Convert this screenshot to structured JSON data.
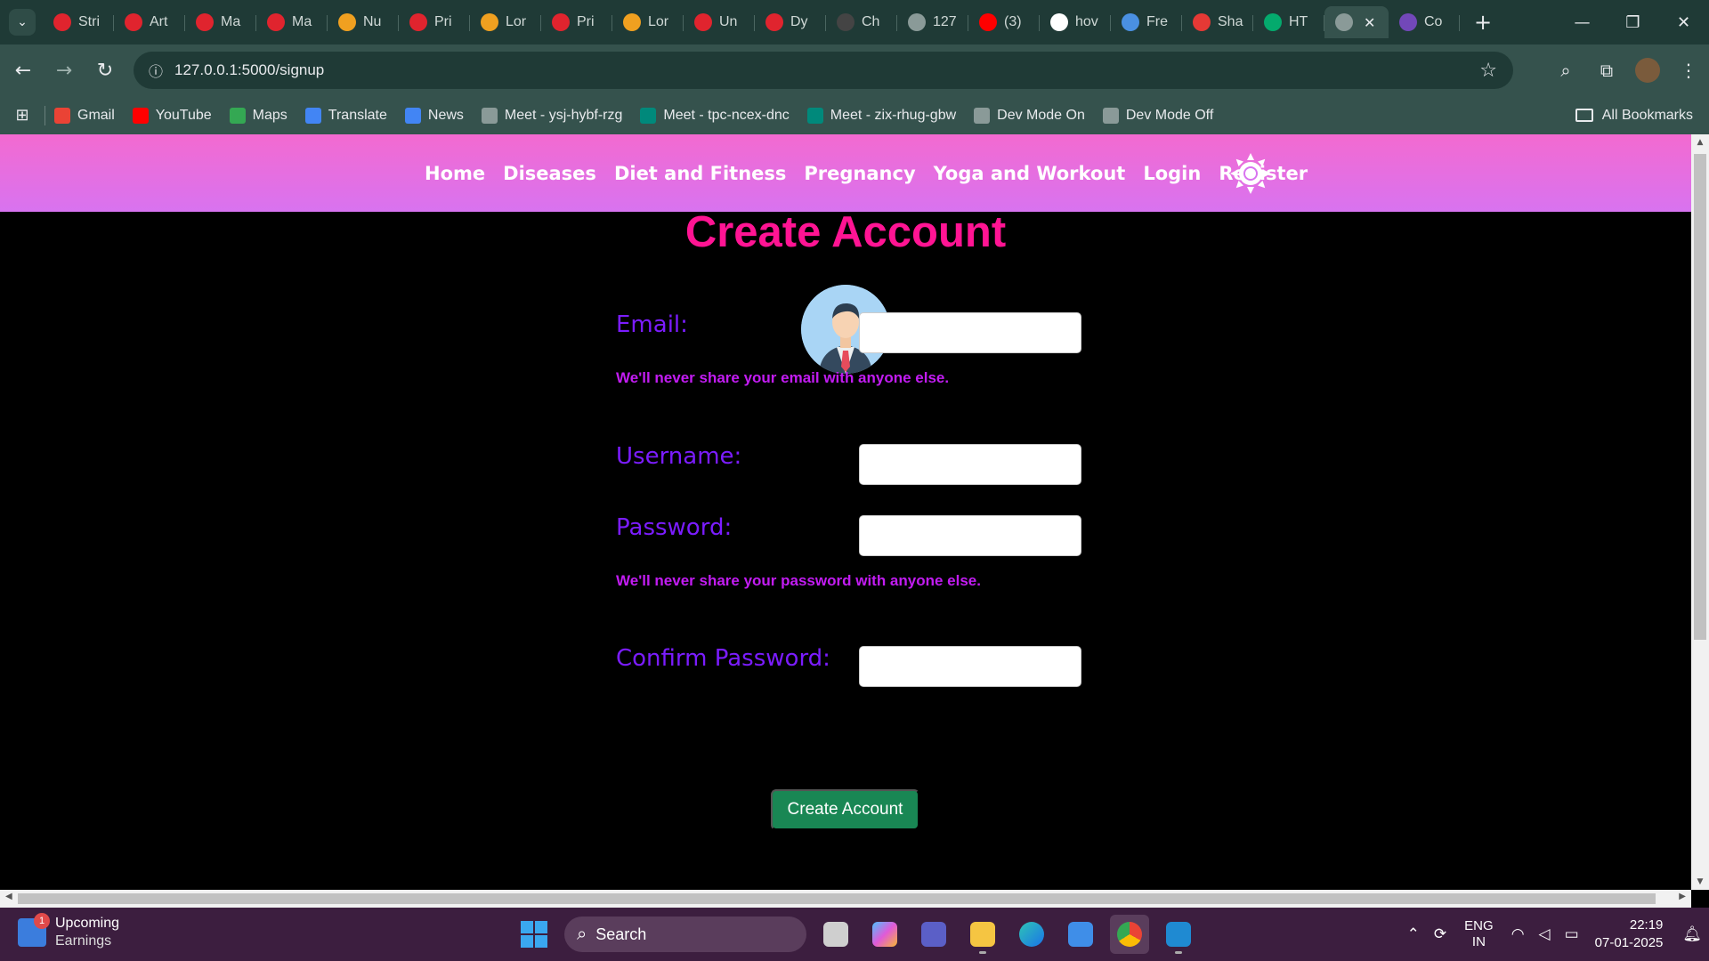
{
  "browser": {
    "tabs": [
      {
        "title": "Stri",
        "icon": "tuf-icon",
        "color": "#e0242e"
      },
      {
        "title": "Art",
        "icon": "tuf-icon",
        "color": "#e0242e"
      },
      {
        "title": "Ma",
        "icon": "tuf-icon",
        "color": "#e0242e"
      },
      {
        "title": "Ma",
        "icon": "tuf-icon",
        "color": "#e0242e"
      },
      {
        "title": "Nu",
        "icon": "leetcode-icon",
        "color": "#f0a020"
      },
      {
        "title": "Pri",
        "icon": "tuf-icon",
        "color": "#e0242e"
      },
      {
        "title": "Lor",
        "icon": "leetcode-icon",
        "color": "#f0a020"
      },
      {
        "title": "Pri",
        "icon": "tuf-icon",
        "color": "#e0242e"
      },
      {
        "title": "Lor",
        "icon": "leetcode-icon",
        "color": "#f0a020"
      },
      {
        "title": "Un",
        "icon": "tuf-icon",
        "color": "#e0242e"
      },
      {
        "title": "Dy",
        "icon": "tuf-icon",
        "color": "#e0242e"
      },
      {
        "title": "Ch",
        "icon": "chatgpt-icon",
        "color": "#444444"
      },
      {
        "title": "127",
        "icon": "globe-icon",
        "color": "#8a9a98"
      },
      {
        "title": "(3)",
        "icon": "youtube-icon",
        "color": "#ff0000"
      },
      {
        "title": "hov",
        "icon": "google-icon",
        "color": "#ffffff"
      },
      {
        "title": "Fre",
        "icon": "generic-icon",
        "color": "#4a90e2"
      },
      {
        "title": "Sha",
        "icon": "generic-icon",
        "color": "#e53935"
      },
      {
        "title": "HT",
        "icon": "w3schools-icon",
        "color": "#04aa6d"
      },
      {
        "title": "",
        "icon": "globe-icon",
        "color": "#8a9a98",
        "active": true
      },
      {
        "title": "Co",
        "icon": "forms-icon",
        "color": "#7248b9"
      }
    ],
    "url": "127.0.0.1:5000/signup",
    "bookmarks": [
      {
        "label": "Gmail",
        "icon": "gmail-icon",
        "color": "#ea4335"
      },
      {
        "label": "YouTube",
        "icon": "youtube-icon",
        "color": "#ff0000"
      },
      {
        "label": "Maps",
        "icon": "maps-icon",
        "color": "#34a853"
      },
      {
        "label": "Translate",
        "icon": "translate-icon",
        "color": "#4285f4"
      },
      {
        "label": "News",
        "icon": "news-icon",
        "color": "#4285f4"
      },
      {
        "label": "Meet - ysj-hybf-rzg",
        "icon": "globe-icon",
        "color": "#8a9a98"
      },
      {
        "label": "Meet - tpc-ncex-dnc",
        "icon": "meet-icon",
        "color": "#00897b"
      },
      {
        "label": "Meet - zix-rhug-gbw",
        "icon": "meet-icon",
        "color": "#00897b"
      },
      {
        "label": "Dev Mode On",
        "icon": "globe-icon",
        "color": "#8a9a98"
      },
      {
        "label": "Dev Mode Off",
        "icon": "globe-icon",
        "color": "#8a9a98"
      }
    ],
    "all_bookmarks": "All Bookmarks"
  },
  "site": {
    "nav": [
      "Home",
      "Diseases",
      "Diet and Fitness",
      "Pregnancy",
      "Yoga and Workout",
      "Login",
      "Register"
    ],
    "title": "Create Account",
    "form": {
      "email_label": "Email:",
      "email_help": "We'll never share your email with anyone else.",
      "username_label": "Username:",
      "password_label": "Password:",
      "password_help": "We'll never share your password with anyone else.",
      "confirm_label": "Confirm Password:",
      "submit": "Create Account"
    },
    "colors": {
      "nav_top": "#f36ad0",
      "title": "#ff1493",
      "label": "#7b1cff",
      "help": "#c21cf2",
      "button": "#198754"
    }
  },
  "taskbar": {
    "widget_title": "Upcoming",
    "widget_sub": "Earnings",
    "widget_badge": "1",
    "search": "Search",
    "lang_1": "ENG",
    "lang_2": "IN",
    "time": "22:19",
    "date": "07-01-2025"
  }
}
